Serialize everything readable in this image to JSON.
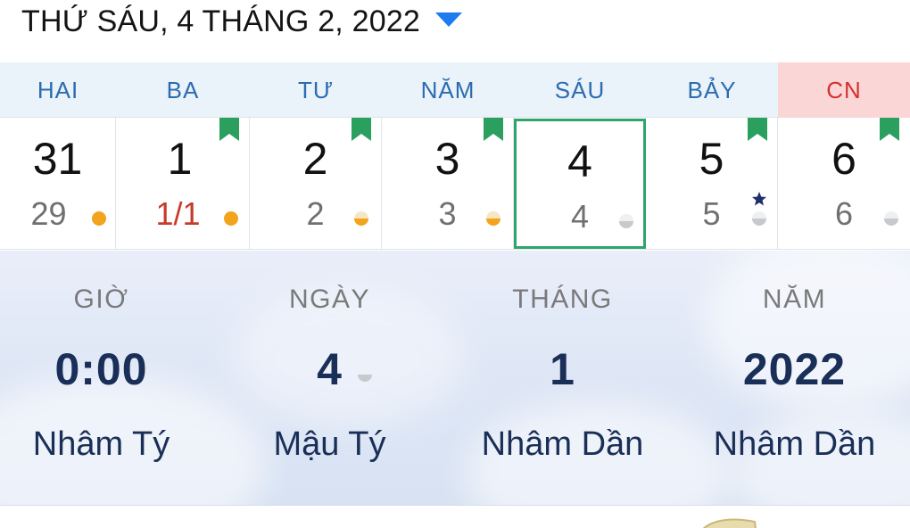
{
  "header": {
    "title": "THỨ SÁU, 4 THÁNG 2, 2022",
    "dropdown_icon": "triangle-down-icon",
    "accent_color": "#1e7cf0"
  },
  "weekdays": [
    "HAI",
    "BA",
    "TƯ",
    "NĂM",
    "SÁU",
    "BẢY",
    "CN"
  ],
  "days": [
    {
      "day": "31",
      "lunar": "29",
      "lunar_red": false,
      "bookmark": false,
      "moon": "full-orange",
      "star": false,
      "selected": false
    },
    {
      "day": "1",
      "lunar": "1/1",
      "lunar_red": true,
      "bookmark": true,
      "moon": "full-orange",
      "star": false,
      "selected": false
    },
    {
      "day": "2",
      "lunar": "2",
      "lunar_red": false,
      "bookmark": true,
      "moon": "half-orange",
      "star": false,
      "selected": false
    },
    {
      "day": "3",
      "lunar": "3",
      "lunar_red": false,
      "bookmark": true,
      "moon": "half-orange",
      "star": false,
      "selected": false
    },
    {
      "day": "4",
      "lunar": "4",
      "lunar_red": false,
      "bookmark": false,
      "moon": "half-gray",
      "star": false,
      "selected": true
    },
    {
      "day": "5",
      "lunar": "5",
      "lunar_red": false,
      "bookmark": true,
      "moon": "half-gray",
      "star": true,
      "selected": false
    },
    {
      "day": "6",
      "lunar": "6",
      "lunar_red": false,
      "bookmark": true,
      "moon": "half-gray",
      "star": false,
      "selected": false
    }
  ],
  "info": {
    "columns": [
      {
        "label": "GIỜ",
        "value": "0:00",
        "name": "Nhâm Tý"
      },
      {
        "label": "NGÀY",
        "value": "4",
        "name": "Mậu Tý"
      },
      {
        "label": "THÁNG",
        "value": "1",
        "name": "Nhâm Dần"
      },
      {
        "label": "NĂM",
        "value": "2022",
        "name": "Nhâm Dần"
      }
    ]
  },
  "colors": {
    "weekday_blue": "#2b6cb0",
    "sunday_red": "#d33131",
    "bookmark_green": "#2ba05e",
    "selected_border": "#2fa56b",
    "moon_orange": "#f2a41c",
    "moon_gray": "#c7c9cd",
    "star_navy": "#1f2f6b",
    "info_text": "#1a2f57"
  }
}
